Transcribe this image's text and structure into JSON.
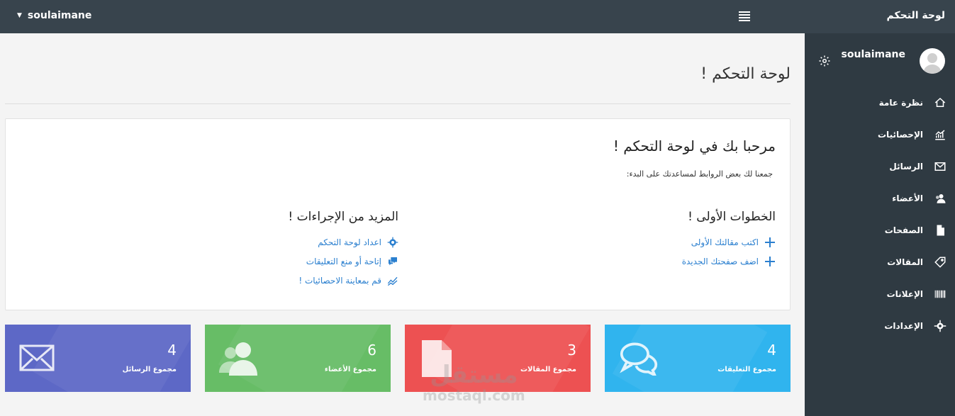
{
  "topbar": {
    "brand": "لوحة التحكم",
    "user": "soulaimane"
  },
  "sidebar": {
    "username": "soulaimane",
    "items": [
      {
        "label": "نظرة عامة",
        "icon": "home-icon"
      },
      {
        "label": "الإحصائيات",
        "icon": "chart-icon"
      },
      {
        "label": "الرسائل",
        "icon": "envelope-icon"
      },
      {
        "label": "الأعضاء",
        "icon": "users-icon"
      },
      {
        "label": "الصفحات",
        "icon": "pages-icon"
      },
      {
        "label": "المقالات",
        "icon": "tag-icon"
      },
      {
        "label": "الإعلانات",
        "icon": "barcode-icon"
      },
      {
        "label": "الإعدادات",
        "icon": "gear-icon"
      }
    ]
  },
  "page": {
    "title": "لوحة التحكم !"
  },
  "welcome": {
    "heading": "مرحبا بك في لوحة التحكم !",
    "subtitle": "جمعنا لك بعض الروابط لمساعدتك على البدء:",
    "first_steps": {
      "title": "الخطوات الأولى !",
      "links": [
        "اكتب مقالتك الأولى",
        "اضف صفحتك الجديدة"
      ]
    },
    "more_actions": {
      "title": "المزيد من الإجراءات !",
      "links": [
        "اعداد لوحة التحكم",
        "إتاحة أو منع التعليقات",
        "قم بمعاينة الاحصائيات !"
      ]
    }
  },
  "stats": [
    {
      "value": "4",
      "label": "مجموع التعليقات",
      "color": "#30b4ee",
      "icon": "comments-icon"
    },
    {
      "value": "3",
      "label": "مجموع المقالات",
      "color": "#ed5152",
      "icon": "document-icon"
    },
    {
      "value": "6",
      "label": "مجموع الأعضاء",
      "color": "#67bd66",
      "icon": "users-icon"
    },
    {
      "value": "4",
      "label": "مجموع الرسائل",
      "color": "#5d68c6",
      "icon": "envelope-icon"
    }
  ],
  "watermark": {
    "arabic": "مستقل",
    "latin": "mostaql.com"
  }
}
